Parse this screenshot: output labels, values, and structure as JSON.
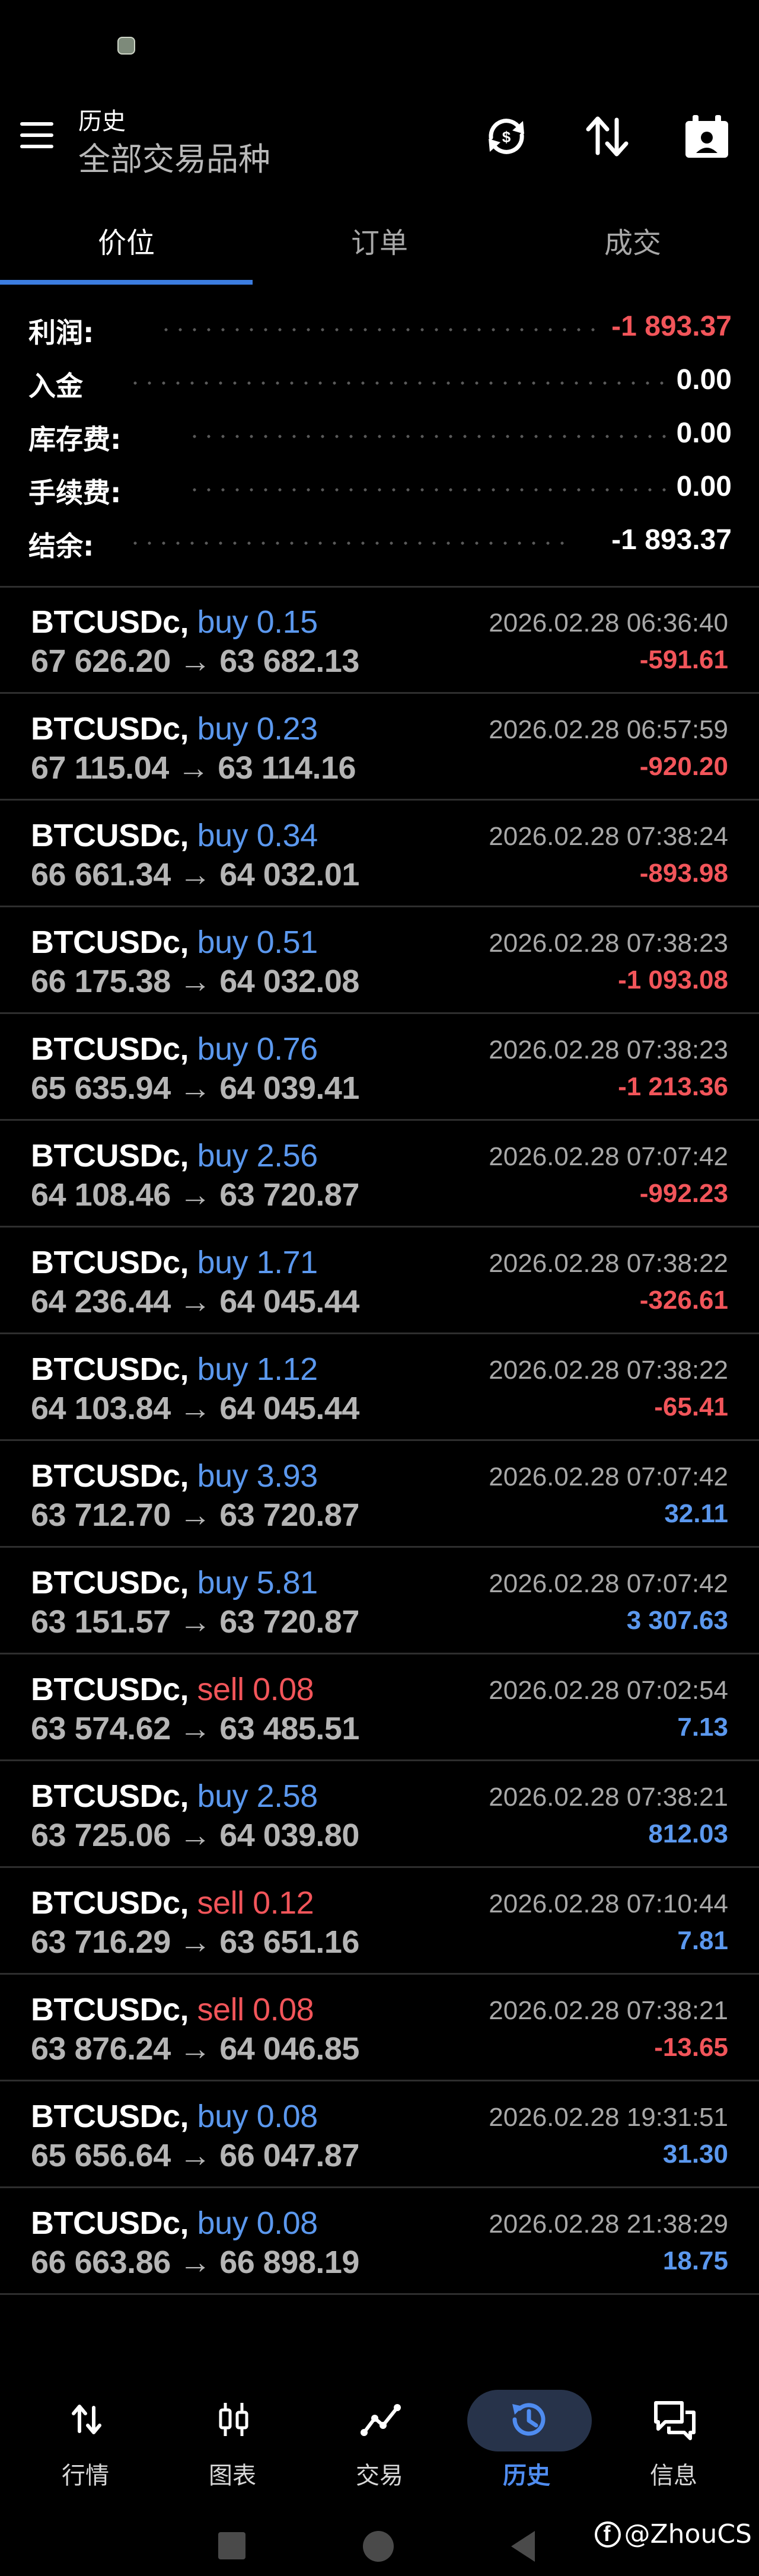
{
  "header": {
    "title": "历史",
    "subtitle": "全部交易品种"
  },
  "tabs": [
    {
      "label": "价位",
      "active": true
    },
    {
      "label": "订单",
      "active": false
    },
    {
      "label": "成交",
      "active": false
    }
  ],
  "summary": {
    "profit": {
      "label": "利润:",
      "value": "-1 893.37"
    },
    "deposit": {
      "label": "入金",
      "value": "0.00"
    },
    "swap": {
      "label": "库存费:",
      "value": "0.00"
    },
    "commission": {
      "label": "手续费:",
      "value": "0.00"
    },
    "balance": {
      "label": "结余:",
      "value": "-1 893.37"
    }
  },
  "deals": [
    {
      "symbol": "BTCUSDc,",
      "side": "buy",
      "volume": "buy 0.15",
      "prices": "67 626.20 → 63 682.13",
      "time": "2026.02.28 06:36:40",
      "profit": "-591.61",
      "profit_sign": "neg"
    },
    {
      "symbol": "BTCUSDc,",
      "side": "buy",
      "volume": "buy 0.23",
      "prices": "67 115.04 → 63 114.16",
      "time": "2026.02.28 06:57:59",
      "profit": "-920.20",
      "profit_sign": "neg"
    },
    {
      "symbol": "BTCUSDc,",
      "side": "buy",
      "volume": "buy 0.34",
      "prices": "66 661.34 → 64 032.01",
      "time": "2026.02.28 07:38:24",
      "profit": "-893.98",
      "profit_sign": "neg"
    },
    {
      "symbol": "BTCUSDc,",
      "side": "buy",
      "volume": "buy 0.51",
      "prices": "66 175.38 → 64 032.08",
      "time": "2026.02.28 07:38:23",
      "profit": "-1 093.08",
      "profit_sign": "neg"
    },
    {
      "symbol": "BTCUSDc,",
      "side": "buy",
      "volume": "buy 0.76",
      "prices": "65 635.94 → 64 039.41",
      "time": "2026.02.28 07:38:23",
      "profit": "-1 213.36",
      "profit_sign": "neg"
    },
    {
      "symbol": "BTCUSDc,",
      "side": "buy",
      "volume": "buy 2.56",
      "prices": "64 108.46 → 63 720.87",
      "time": "2026.02.28 07:07:42",
      "profit": "-992.23",
      "profit_sign": "neg"
    },
    {
      "symbol": "BTCUSDc,",
      "side": "buy",
      "volume": "buy 1.71",
      "prices": "64 236.44 → 64 045.44",
      "time": "2026.02.28 07:38:22",
      "profit": "-326.61",
      "profit_sign": "neg"
    },
    {
      "symbol": "BTCUSDc,",
      "side": "buy",
      "volume": "buy 1.12",
      "prices": "64 103.84 → 64 045.44",
      "time": "2026.02.28 07:38:22",
      "profit": "-65.41",
      "profit_sign": "neg"
    },
    {
      "symbol": "BTCUSDc,",
      "side": "buy",
      "volume": "buy 3.93",
      "prices": "63 712.70 → 63 720.87",
      "time": "2026.02.28 07:07:42",
      "profit": "32.11",
      "profit_sign": "pos"
    },
    {
      "symbol": "BTCUSDc,",
      "side": "buy",
      "volume": "buy 5.81",
      "prices": "63 151.57 → 63 720.87",
      "time": "2026.02.28 07:07:42",
      "profit": "3 307.63",
      "profit_sign": "pos"
    },
    {
      "symbol": "BTCUSDc,",
      "side": "sell",
      "volume": "sell 0.08",
      "prices": "63 574.62 → 63 485.51",
      "time": "2026.02.28 07:02:54",
      "profit": "7.13",
      "profit_sign": "pos"
    },
    {
      "symbol": "BTCUSDc,",
      "side": "buy",
      "volume": "buy 2.58",
      "prices": "63 725.06 → 64 039.80",
      "time": "2026.02.28 07:38:21",
      "profit": "812.03",
      "profit_sign": "pos"
    },
    {
      "symbol": "BTCUSDc,",
      "side": "sell",
      "volume": "sell 0.12",
      "prices": "63 716.29 → 63 651.16",
      "time": "2026.02.28 07:10:44",
      "profit": "7.81",
      "profit_sign": "pos"
    },
    {
      "symbol": "BTCUSDc,",
      "side": "sell",
      "volume": "sell 0.08",
      "prices": "63 876.24 → 64 046.85",
      "time": "2026.02.28 07:38:21",
      "profit": "-13.65",
      "profit_sign": "neg"
    },
    {
      "symbol": "BTCUSDc,",
      "side": "buy",
      "volume": "buy 0.08",
      "prices": "65 656.64 → 66 047.87",
      "time": "2026.02.28 19:31:51",
      "profit": "31.30",
      "profit_sign": "pos"
    },
    {
      "symbol": "BTCUSDc,",
      "side": "buy",
      "volume": "buy 0.08",
      "prices": "66 663.86 → 66 898.19",
      "time": "2026.02.28 21:38:29",
      "profit": "18.75",
      "profit_sign": "pos"
    }
  ],
  "bottom_nav": [
    {
      "label": "行情",
      "icon": "quotes-arrows-icon",
      "active": false
    },
    {
      "label": "图表",
      "icon": "candlestick-chart-icon",
      "active": false
    },
    {
      "label": "交易",
      "icon": "trade-line-icon",
      "active": false
    },
    {
      "label": "历史",
      "icon": "history-clock-icon",
      "active": true
    },
    {
      "label": "信息",
      "icon": "messages-icon",
      "active": false
    }
  ],
  "watermark": "@ZhouCS",
  "colors": {
    "background": "#000000",
    "accent": "#3c7de0",
    "negative": "#f2555a",
    "positive": "#5b98ee",
    "active_nav_pill": "#27334a"
  }
}
